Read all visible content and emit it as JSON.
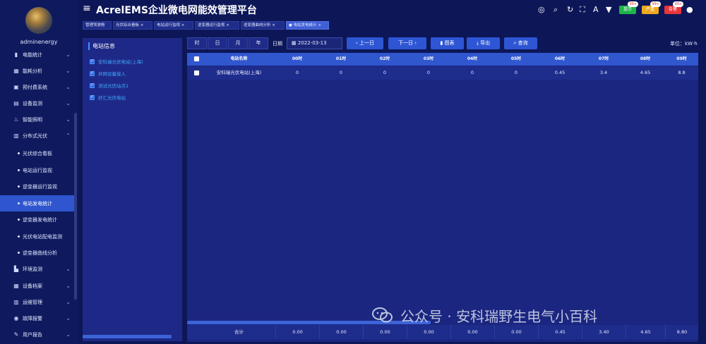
{
  "app": {
    "title": "AcrelEMS企业微电网能效管理平台",
    "username": "adminenergy"
  },
  "sidebar": {
    "items": [
      {
        "label": "电能统计",
        "icon": "bar-chart-icon"
      },
      {
        "label": "能耗分析",
        "icon": "analysis-icon"
      },
      {
        "label": "预付费系统",
        "icon": "prepay-icon"
      },
      {
        "label": "设备监测",
        "icon": "monitor-icon"
      },
      {
        "label": "智能照明",
        "icon": "lighting-icon"
      },
      {
        "label": "分布式光伏",
        "icon": "solar-icon"
      }
    ],
    "subitems": [
      "光伏综合看板",
      "电站运行监视",
      "逆变器运行监视",
      "电站发电统计",
      "逆变器发电统计",
      "光伏电站配电监测",
      "逆变器曲线分析"
    ],
    "items_after": [
      {
        "label": "环境监测",
        "icon": "environment-icon"
      },
      {
        "label": "设备档案",
        "icon": "archive-icon"
      },
      {
        "label": "运维管理",
        "icon": "maintenance-icon"
      },
      {
        "label": "故障报警",
        "icon": "alarm-icon"
      },
      {
        "label": "用户报告",
        "icon": "report-icon"
      }
    ]
  },
  "header": {
    "badges": [
      {
        "label": "提示",
        "count": "99+",
        "color": "#1fb34a"
      },
      {
        "label": "严重",
        "count": "99+",
        "color": "#f0a81f"
      },
      {
        "label": "告警",
        "count": "99+",
        "color": "#e8353c"
      }
    ]
  },
  "tabs": [
    "管理驾驶舱",
    "光伏综合看板",
    "电站运行监视",
    "逆变器运行监视",
    "逆变器曲线分析",
    "电站发电统计"
  ],
  "station_panel": {
    "title": "电站信息",
    "stations": [
      "安科瑞光伏电站(上海)",
      "并网设备接入",
      "测试光伏站点1",
      "好汇光伏电站"
    ]
  },
  "toolbar": {
    "segments": [
      "时",
      "日",
      "月",
      "年"
    ],
    "date_label": "日期",
    "date_value": "2022-03-13",
    "prev_label": "上一日",
    "next_label": "下一日",
    "chart_label": "图表",
    "export_label": "导出",
    "query_label": "查询",
    "unit_text": "单位：kW·h"
  },
  "table": {
    "columns": [
      "电站名称",
      "00时",
      "01时",
      "02时",
      "03时",
      "04时",
      "05时",
      "06时",
      "07时",
      "08时",
      "09时"
    ],
    "row": [
      "安科瑞光伏电站(上海)",
      "0",
      "0",
      "0",
      "0",
      "0",
      "0",
      "0.45",
      "3.4",
      "4.65",
      "8.8"
    ],
    "footer_label": "合计",
    "footer": [
      "0.00",
      "0.00",
      "0.00",
      "0.00",
      "0.00",
      "0.00",
      "0.45",
      "3.40",
      "4.65",
      "8.80"
    ]
  },
  "watermark": {
    "text": "公众号 · 安科瑞野生电气小百科"
  }
}
